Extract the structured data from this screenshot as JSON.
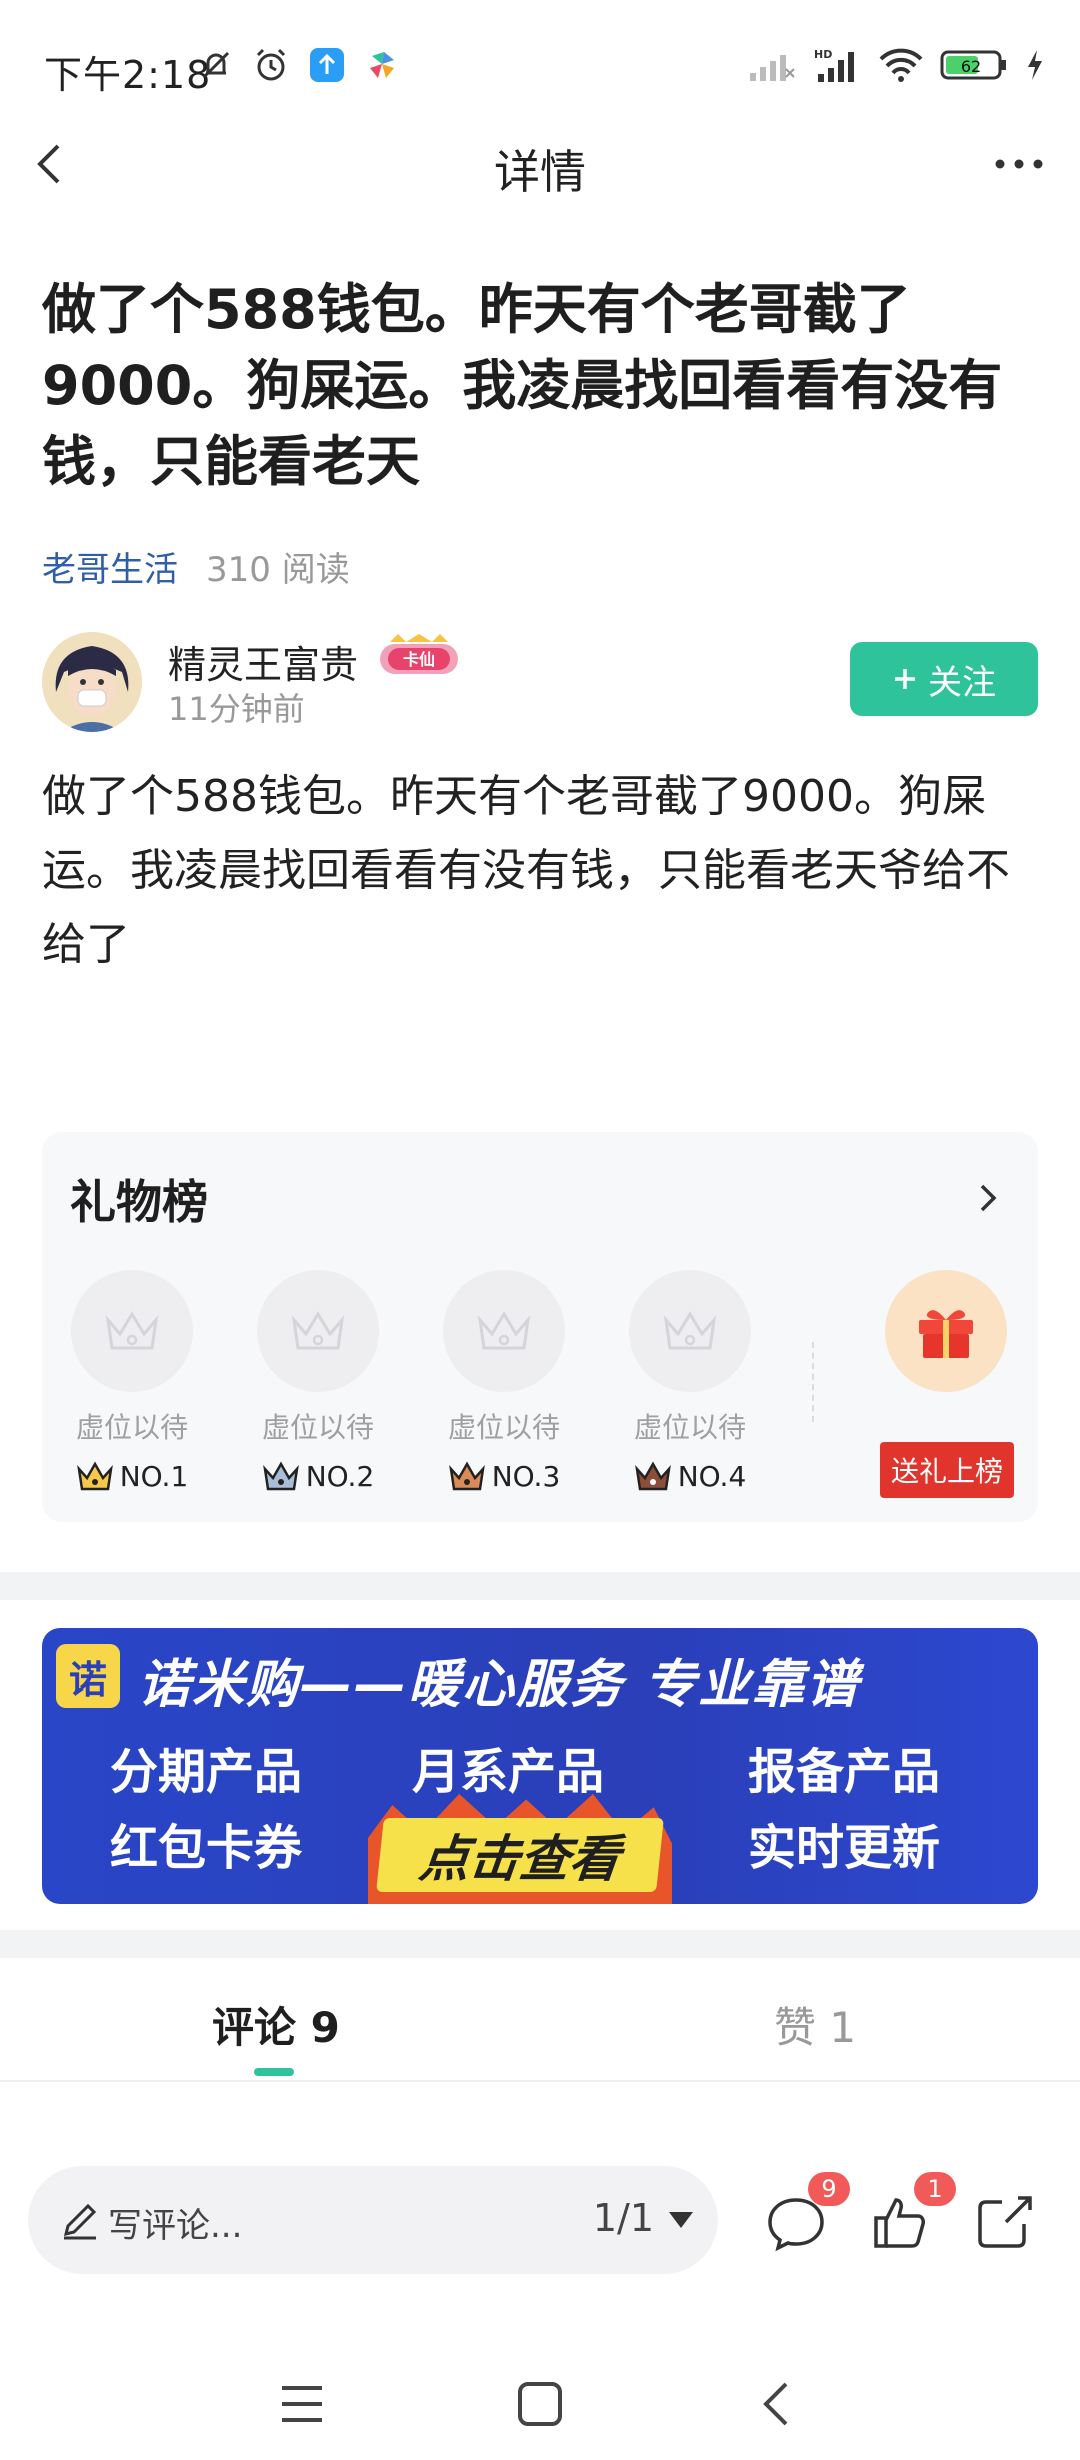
{
  "status_bar": {
    "time": "下午2:18",
    "battery_level": "62",
    "network_label": "HD"
  },
  "nav": {
    "title": "详情"
  },
  "post": {
    "title": "做了个588钱包。昨天有个老哥截了9000。狗屎运。我凌晨找回看看有没有钱，只能看老天",
    "category": "老哥生活",
    "reads": "310 阅读",
    "body": "做了个588钱包。昨天有个老哥截了9000。狗屎运。我凌晨找回看看有没有钱，只能看老天爷给不给了"
  },
  "author": {
    "name": "精灵王富贵",
    "badge": "卡仙",
    "time": "11分钟前",
    "follow_label": "关注"
  },
  "gift_board": {
    "title": "礼物榜",
    "slots": [
      {
        "label": "虚位以待",
        "rank": "NO.1",
        "crown_color": "#e7b530"
      },
      {
        "label": "虚位以待",
        "rank": "NO.2",
        "crown_color": "#8fa3c2"
      },
      {
        "label": "虚位以待",
        "rank": "NO.3",
        "crown_color": "#c97a4a"
      },
      {
        "label": "虚位以待",
        "rank": "NO.4",
        "crown_color": "#8a4e3a"
      }
    ],
    "send_label": "送礼上榜"
  },
  "banner": {
    "logo": "诺",
    "headline": "诺米购——暖心服务 专业靠谱",
    "items": [
      "分期产品",
      "月系产品",
      "报备产品",
      "红包卡券",
      "实时更新"
    ],
    "cta": "点击查看"
  },
  "tabs": {
    "comments": "评论 9",
    "likes": "赞 1"
  },
  "action_bar": {
    "comment_placeholder": "写评论...",
    "page": "1/1",
    "comment_badge": "9",
    "like_badge": "1"
  },
  "colors": {
    "accent": "#2fc39b",
    "category_link": "#2e5fa8",
    "gift_button": "#e0342c",
    "badge": "#f25a5a",
    "banner_bg": "#2a3fb8"
  }
}
